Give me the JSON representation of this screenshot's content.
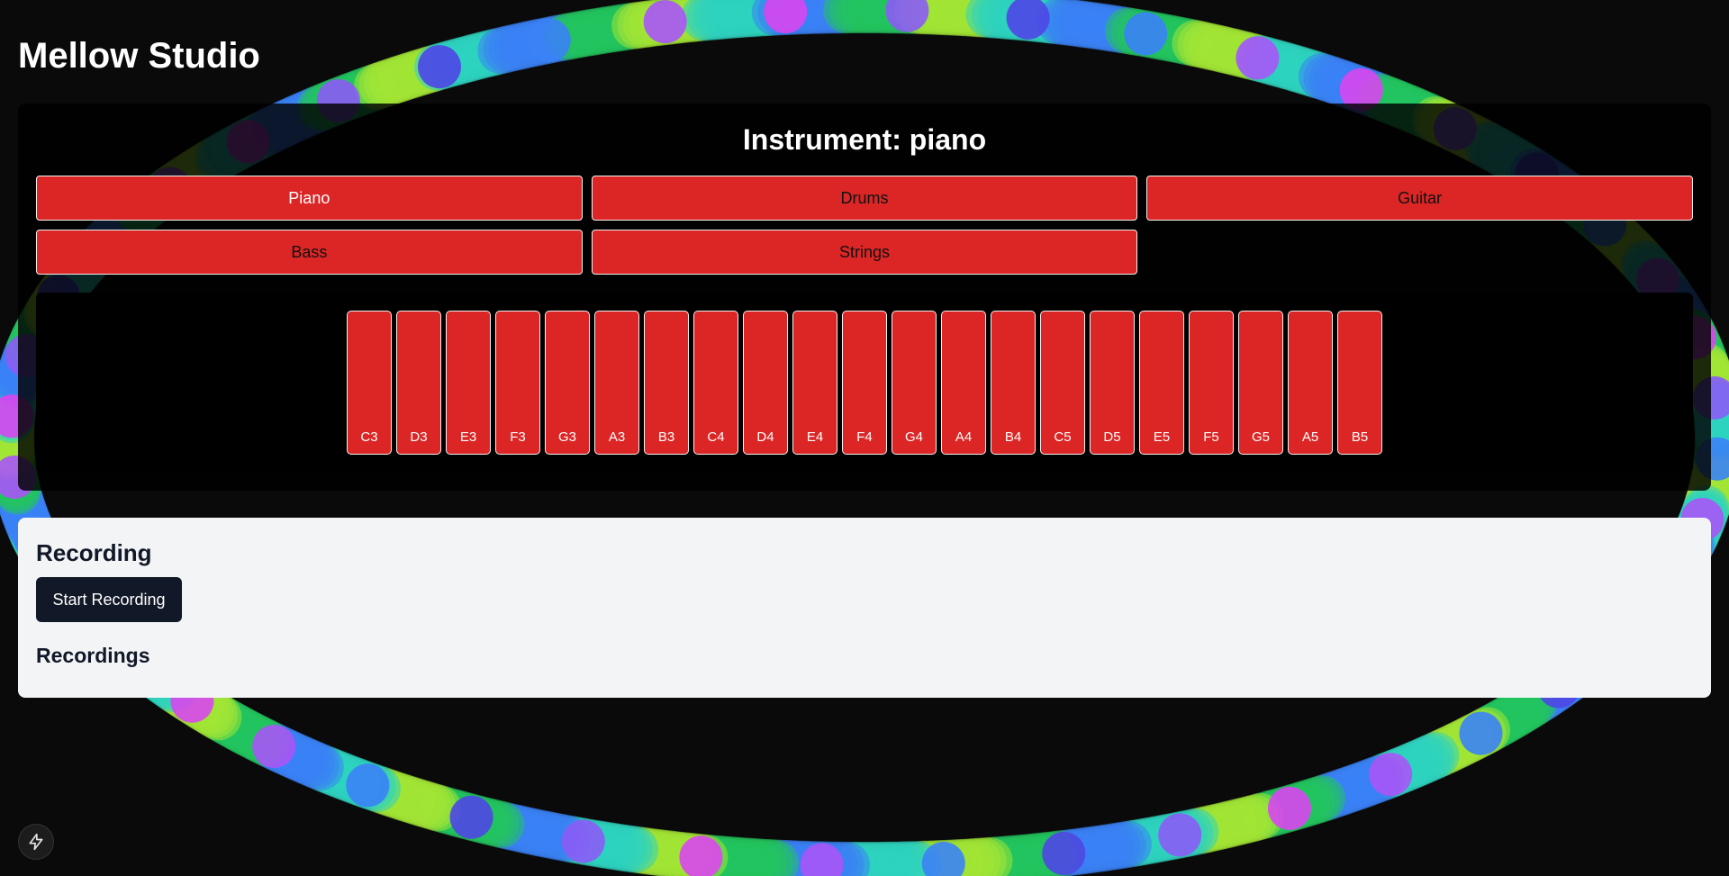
{
  "app": {
    "title": "Mellow Studio"
  },
  "instrument": {
    "heading": "Instrument: piano",
    "options": [
      {
        "label": "Piano",
        "active": true
      },
      {
        "label": "Drums",
        "active": false
      },
      {
        "label": "Guitar",
        "active": false
      },
      {
        "label": "Bass",
        "active": false
      },
      {
        "label": "Strings",
        "active": false
      }
    ]
  },
  "keyboard": {
    "keys": [
      "C3",
      "D3",
      "E3",
      "F3",
      "G3",
      "A3",
      "B3",
      "C4",
      "D4",
      "E4",
      "F4",
      "G4",
      "A4",
      "B4",
      "C5",
      "D5",
      "E5",
      "F5",
      "G5",
      "A5",
      "B5"
    ]
  },
  "recording": {
    "heading": "Recording",
    "start_button_label": "Start Recording",
    "recordings_heading": "Recordings"
  },
  "corner_button": {
    "icon": "lightning-icon"
  },
  "colors": {
    "background": "#0a0a0a",
    "accent_red": "#dc2626",
    "panel_light": "#f3f4f6",
    "button_dark": "#111827",
    "ring_palette": [
      "#22c55e",
      "#a3e635",
      "#2dd4bf",
      "#3b82f6",
      "#a855f7",
      "#d946ef",
      "#8b5cf6",
      "#4f46e5"
    ]
  }
}
